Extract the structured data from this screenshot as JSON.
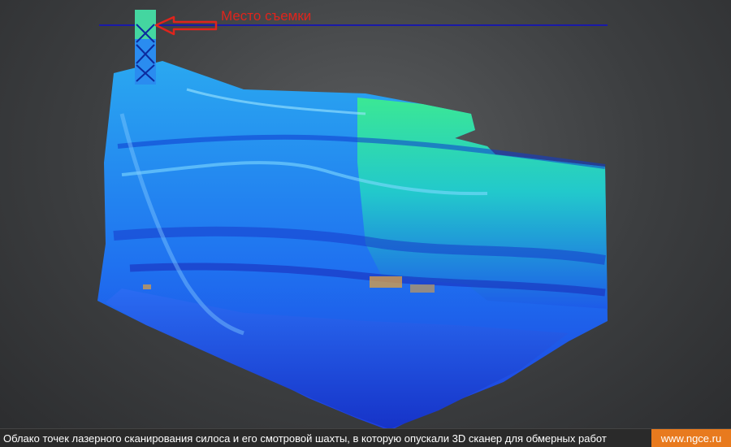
{
  "annotation": {
    "label": "Место съемки",
    "color": "#e0241c",
    "reference_line_color": "#1a1aa8"
  },
  "point_cloud": {
    "colors": {
      "low": "#1d3fe0",
      "mid": "#1f9cf0",
      "high": "#3df08a",
      "accent": "#e0a040"
    }
  },
  "footer": {
    "caption": "Облако точек лазерного сканирования силоса и его смотровой шахты, в которую опускали 3D сканер для обмерных работ",
    "site": "www.ngce.ru",
    "site_color": "#e87a1e"
  }
}
